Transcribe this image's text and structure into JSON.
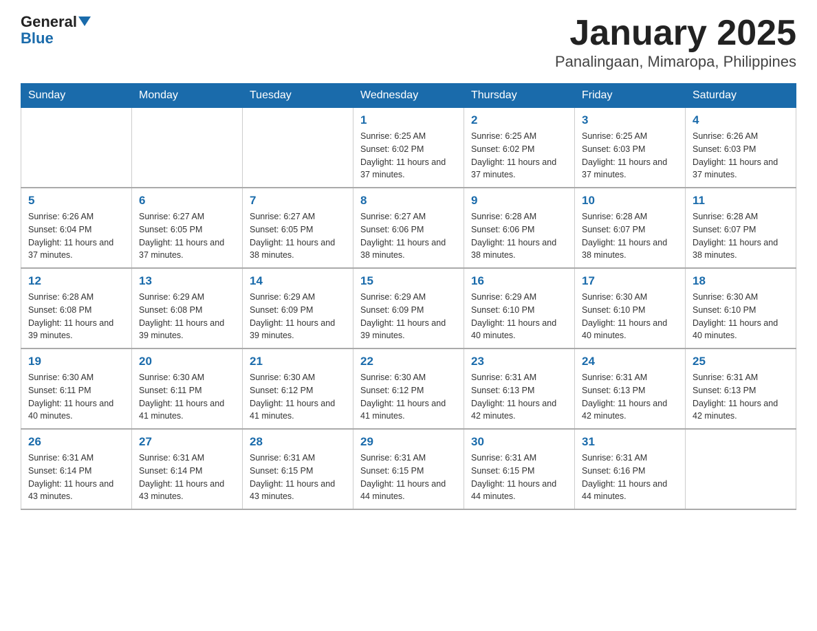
{
  "header": {
    "logo_general": "General",
    "logo_blue": "Blue",
    "title": "January 2025",
    "subtitle": "Panalingaan, Mimaropa, Philippines"
  },
  "days_of_week": [
    "Sunday",
    "Monday",
    "Tuesday",
    "Wednesday",
    "Thursday",
    "Friday",
    "Saturday"
  ],
  "weeks": [
    [
      {
        "day": "",
        "info": ""
      },
      {
        "day": "",
        "info": ""
      },
      {
        "day": "",
        "info": ""
      },
      {
        "day": "1",
        "info": "Sunrise: 6:25 AM\nSunset: 6:02 PM\nDaylight: 11 hours and 37 minutes."
      },
      {
        "day": "2",
        "info": "Sunrise: 6:25 AM\nSunset: 6:02 PM\nDaylight: 11 hours and 37 minutes."
      },
      {
        "day": "3",
        "info": "Sunrise: 6:25 AM\nSunset: 6:03 PM\nDaylight: 11 hours and 37 minutes."
      },
      {
        "day": "4",
        "info": "Sunrise: 6:26 AM\nSunset: 6:03 PM\nDaylight: 11 hours and 37 minutes."
      }
    ],
    [
      {
        "day": "5",
        "info": "Sunrise: 6:26 AM\nSunset: 6:04 PM\nDaylight: 11 hours and 37 minutes."
      },
      {
        "day": "6",
        "info": "Sunrise: 6:27 AM\nSunset: 6:05 PM\nDaylight: 11 hours and 37 minutes."
      },
      {
        "day": "7",
        "info": "Sunrise: 6:27 AM\nSunset: 6:05 PM\nDaylight: 11 hours and 38 minutes."
      },
      {
        "day": "8",
        "info": "Sunrise: 6:27 AM\nSunset: 6:06 PM\nDaylight: 11 hours and 38 minutes."
      },
      {
        "day": "9",
        "info": "Sunrise: 6:28 AM\nSunset: 6:06 PM\nDaylight: 11 hours and 38 minutes."
      },
      {
        "day": "10",
        "info": "Sunrise: 6:28 AM\nSunset: 6:07 PM\nDaylight: 11 hours and 38 minutes."
      },
      {
        "day": "11",
        "info": "Sunrise: 6:28 AM\nSunset: 6:07 PM\nDaylight: 11 hours and 38 minutes."
      }
    ],
    [
      {
        "day": "12",
        "info": "Sunrise: 6:28 AM\nSunset: 6:08 PM\nDaylight: 11 hours and 39 minutes."
      },
      {
        "day": "13",
        "info": "Sunrise: 6:29 AM\nSunset: 6:08 PM\nDaylight: 11 hours and 39 minutes."
      },
      {
        "day": "14",
        "info": "Sunrise: 6:29 AM\nSunset: 6:09 PM\nDaylight: 11 hours and 39 minutes."
      },
      {
        "day": "15",
        "info": "Sunrise: 6:29 AM\nSunset: 6:09 PM\nDaylight: 11 hours and 39 minutes."
      },
      {
        "day": "16",
        "info": "Sunrise: 6:29 AM\nSunset: 6:10 PM\nDaylight: 11 hours and 40 minutes."
      },
      {
        "day": "17",
        "info": "Sunrise: 6:30 AM\nSunset: 6:10 PM\nDaylight: 11 hours and 40 minutes."
      },
      {
        "day": "18",
        "info": "Sunrise: 6:30 AM\nSunset: 6:10 PM\nDaylight: 11 hours and 40 minutes."
      }
    ],
    [
      {
        "day": "19",
        "info": "Sunrise: 6:30 AM\nSunset: 6:11 PM\nDaylight: 11 hours and 40 minutes."
      },
      {
        "day": "20",
        "info": "Sunrise: 6:30 AM\nSunset: 6:11 PM\nDaylight: 11 hours and 41 minutes."
      },
      {
        "day": "21",
        "info": "Sunrise: 6:30 AM\nSunset: 6:12 PM\nDaylight: 11 hours and 41 minutes."
      },
      {
        "day": "22",
        "info": "Sunrise: 6:30 AM\nSunset: 6:12 PM\nDaylight: 11 hours and 41 minutes."
      },
      {
        "day": "23",
        "info": "Sunrise: 6:31 AM\nSunset: 6:13 PM\nDaylight: 11 hours and 42 minutes."
      },
      {
        "day": "24",
        "info": "Sunrise: 6:31 AM\nSunset: 6:13 PM\nDaylight: 11 hours and 42 minutes."
      },
      {
        "day": "25",
        "info": "Sunrise: 6:31 AM\nSunset: 6:13 PM\nDaylight: 11 hours and 42 minutes."
      }
    ],
    [
      {
        "day": "26",
        "info": "Sunrise: 6:31 AM\nSunset: 6:14 PM\nDaylight: 11 hours and 43 minutes."
      },
      {
        "day": "27",
        "info": "Sunrise: 6:31 AM\nSunset: 6:14 PM\nDaylight: 11 hours and 43 minutes."
      },
      {
        "day": "28",
        "info": "Sunrise: 6:31 AM\nSunset: 6:15 PM\nDaylight: 11 hours and 43 minutes."
      },
      {
        "day": "29",
        "info": "Sunrise: 6:31 AM\nSunset: 6:15 PM\nDaylight: 11 hours and 44 minutes."
      },
      {
        "day": "30",
        "info": "Sunrise: 6:31 AM\nSunset: 6:15 PM\nDaylight: 11 hours and 44 minutes."
      },
      {
        "day": "31",
        "info": "Sunrise: 6:31 AM\nSunset: 6:16 PM\nDaylight: 11 hours and 44 minutes."
      },
      {
        "day": "",
        "info": ""
      }
    ]
  ]
}
